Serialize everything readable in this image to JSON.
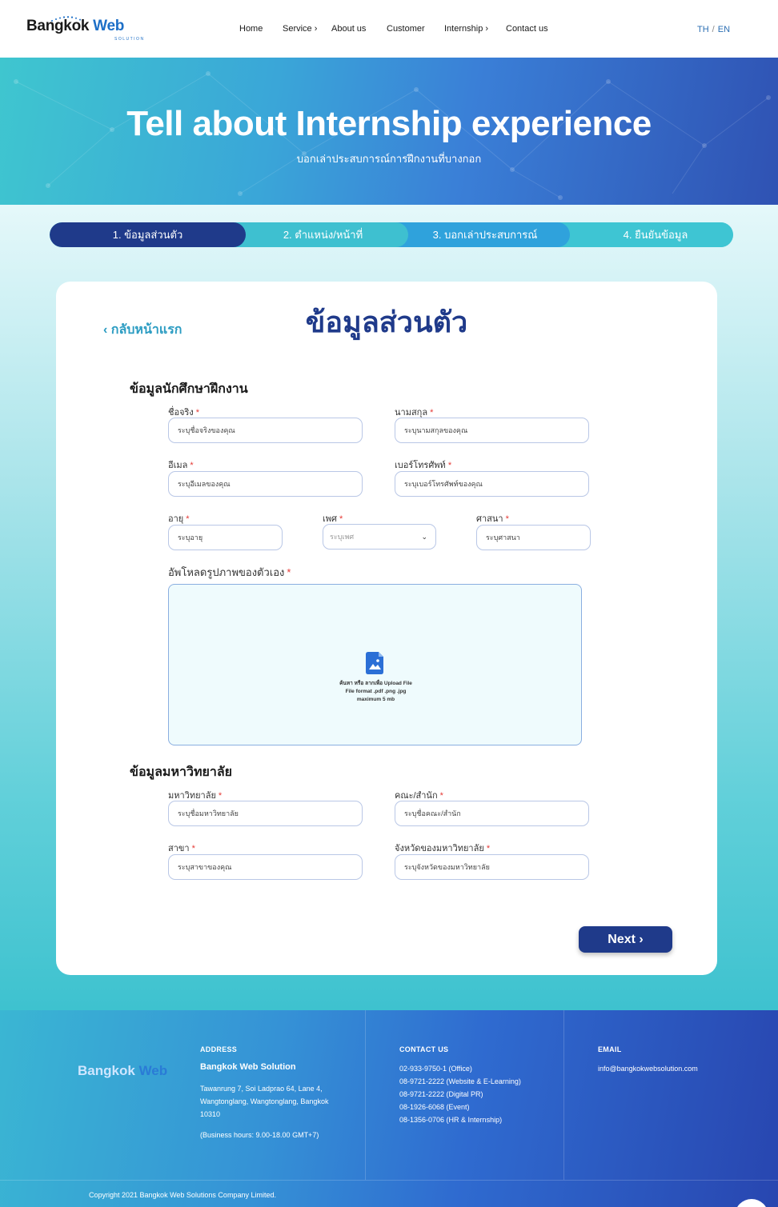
{
  "header": {
    "logo": {
      "main": "Bangk",
      "o_glyph": "o",
      "tail": "k",
      "web": "Web",
      "sub": "SOLUTION"
    },
    "nav": [
      {
        "label": "Home",
        "has_chevron": false
      },
      {
        "label": "Service",
        "has_chevron": true
      },
      {
        "label": "About us",
        "has_chevron": false
      },
      {
        "label": "Customer",
        "has_chevron": false
      },
      {
        "label": "Internship",
        "has_chevron": true
      },
      {
        "label": "Contact us",
        "has_chevron": false
      }
    ],
    "chevron": "›",
    "lang": {
      "th": "TH",
      "separator": "/",
      "en": "EN"
    }
  },
  "hero": {
    "title": "Tell about Internship experience",
    "subtitle": "บอกเล่าประสบการณ์การฝึกงานที่บางกอก"
  },
  "steps": [
    {
      "label": "1. ข้อมูลส่วนตัว",
      "active": true
    },
    {
      "label": "2. ตำแหน่ง/หน้าที่",
      "active": false
    },
    {
      "label": "3. บอกเล่าประสบการณ์",
      "active": false
    },
    {
      "label": "4. ยืนยันข้อมูล",
      "active": false
    }
  ],
  "card": {
    "back_link": "‹ กลับหน้าแรก",
    "title": "ข้อมูลส่วนตัว",
    "section_student": "ข้อมูลนักศึกษาฝึกงาน",
    "section_university": "ข้อมูลมหาวิทยาลัย",
    "required_mark": "*",
    "fields": {
      "first_name": {
        "label": "ชื่อจริง",
        "placeholder": "ระบุชื่อจริงของคุณ"
      },
      "last_name": {
        "label": "นามสกุล",
        "placeholder": "ระบุนามสกุลของคุณ"
      },
      "email": {
        "label": "อีเมล",
        "placeholder": "ระบุอีเมลของคุณ"
      },
      "phone": {
        "label": "เบอร์โทรศัพท์",
        "placeholder": "ระบุเบอร์โทรศัพท์ของคุณ"
      },
      "age": {
        "label": "อายุ",
        "placeholder": "ระบุอายุ"
      },
      "gender": {
        "label": "เพศ",
        "placeholder": "ระบุเพศ"
      },
      "religion": {
        "label": "ศาสนา",
        "placeholder": "ระบุศาสนา"
      },
      "university": {
        "label": "มหาวิทยาลัย",
        "placeholder": "ระบุชื่อมหาวิทยาลัย"
      },
      "faculty": {
        "label": "คณะ/สำนัก",
        "placeholder": "ระบุชื่อคณะ/สำนัก"
      },
      "major": {
        "label": "สาขา",
        "placeholder": "ระบุสาขาของคุณ"
      },
      "province": {
        "label": "จังหวัดของมหาวิทยาลัย",
        "placeholder": "ระบุจังหวัดของมหาวิทยาลัย"
      }
    },
    "upload": {
      "label": "อัพโหลดรูปภาพของตัวเอง",
      "line1": "ค้นหา หรือ ลากเพื่อ Upload File",
      "line2": "File format .pdf .png .jpg",
      "line3": "maximum 5 mb"
    },
    "next_button": "Next ›"
  },
  "footer": {
    "logo": {
      "main": "Bangk",
      "o_glyph": "o",
      "tail": "k",
      "web": "Web",
      "sub": "SOLUTION"
    },
    "address": {
      "heading": "ADDRESS",
      "company": "Bangkok Web Solution",
      "line1": "Tawanrung 7, Soi Ladprao 64, Lane 4,",
      "line2": "Wangtonglang, Wangtonglang, Bangkok",
      "line3": "10310",
      "hours": "(Business hours: 9.00-18.00 GMT+7)"
    },
    "contact": {
      "heading": "CONTACT US",
      "lines": [
        "02-933-9750-1 (Office)",
        "08-9721-2222 (Website & E-Learning)",
        "08-9721-2222 (Digital PR)",
        "08-1926-6068 (Event)",
        "08-1356-0706 (HR & Internship)"
      ]
    },
    "email": {
      "heading": "EMAIL",
      "value": "info@bangkokwebsolution.com"
    },
    "copyright": "Copyright 2021 Bangkok Web Solutions Company Limited."
  },
  "colors": {
    "navy": "#1f3a8a",
    "accent_blue": "#1d6fc7",
    "teal": "#3fc6d4",
    "required": "#e53935"
  },
  "icons": {
    "upload": "image-file-upload-icon",
    "nav_chevron": "chevron-right-icon",
    "select_caret": "chevron-down-icon"
  }
}
